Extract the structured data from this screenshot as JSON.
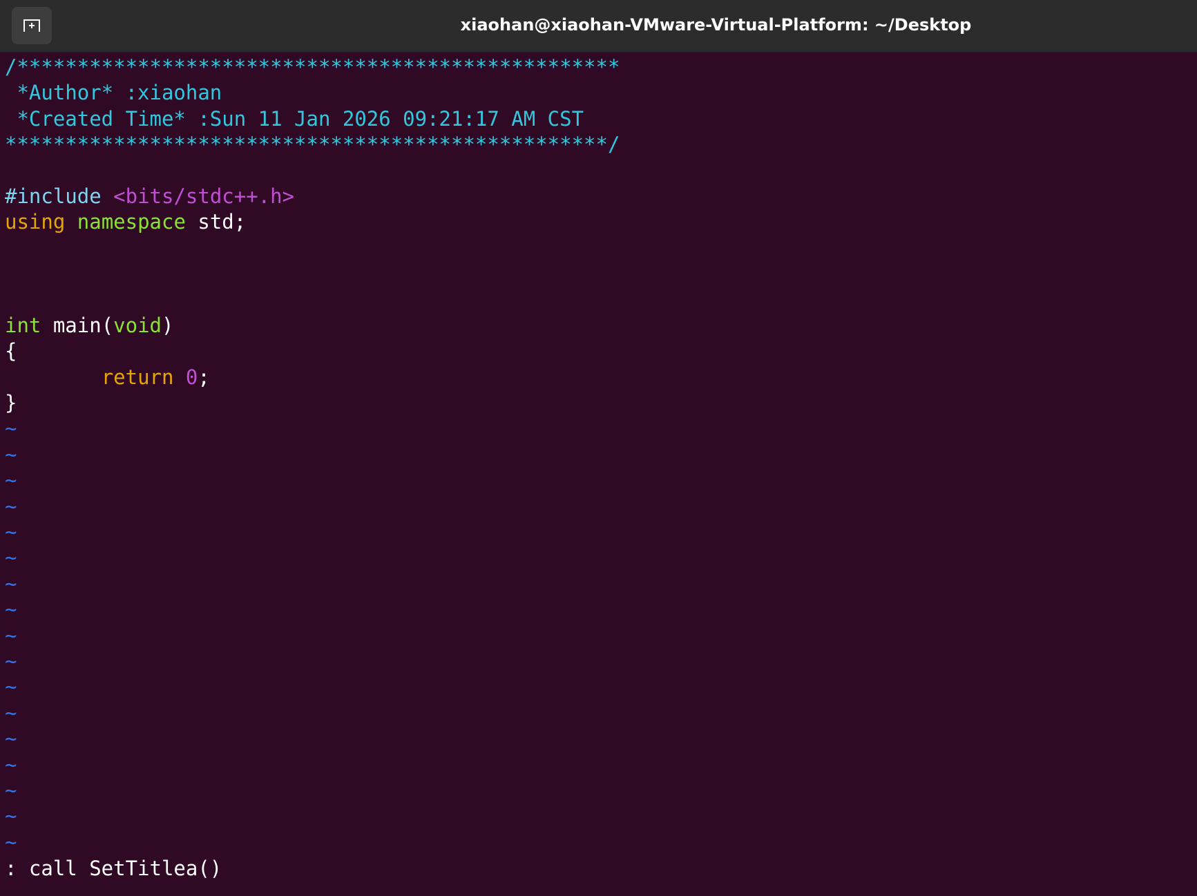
{
  "window": {
    "title": "xiaohan@xiaohan-VMware-Virtual-Platform: ~/Desktop",
    "new_tab_icon": "new-tab-icon"
  },
  "editor": {
    "header": {
      "open": "/**************************************************",
      "author_label": " *Author* :xiaohan",
      "created_label": " *Created Time* :Sun 11 Jan 2026 09:21:17 AM CST",
      "close": "**************************************************/"
    },
    "include": {
      "directive": "#include",
      "header": "<bits/stdc++.h>"
    },
    "using": {
      "keyword": "using",
      "ns_keyword": "namespace",
      "rest": " std;"
    },
    "main": {
      "type": "int",
      "name": " main(",
      "param": "void",
      "close": ")",
      "open_brace": "{",
      "return_kw": "return",
      "return_val": "0",
      "semicolon": ";",
      "close_brace": "}"
    },
    "tilde": "~",
    "tilde_count": 17
  },
  "command_line": ": call SetTitlea()",
  "colors": {
    "background": "#300a24",
    "titlebar": "#2c2c2c",
    "comment": "#33c7de",
    "string": "#c14fd6",
    "keyword": "#e5a50a",
    "type": "#8ae234",
    "tilde": "#3473e8"
  }
}
